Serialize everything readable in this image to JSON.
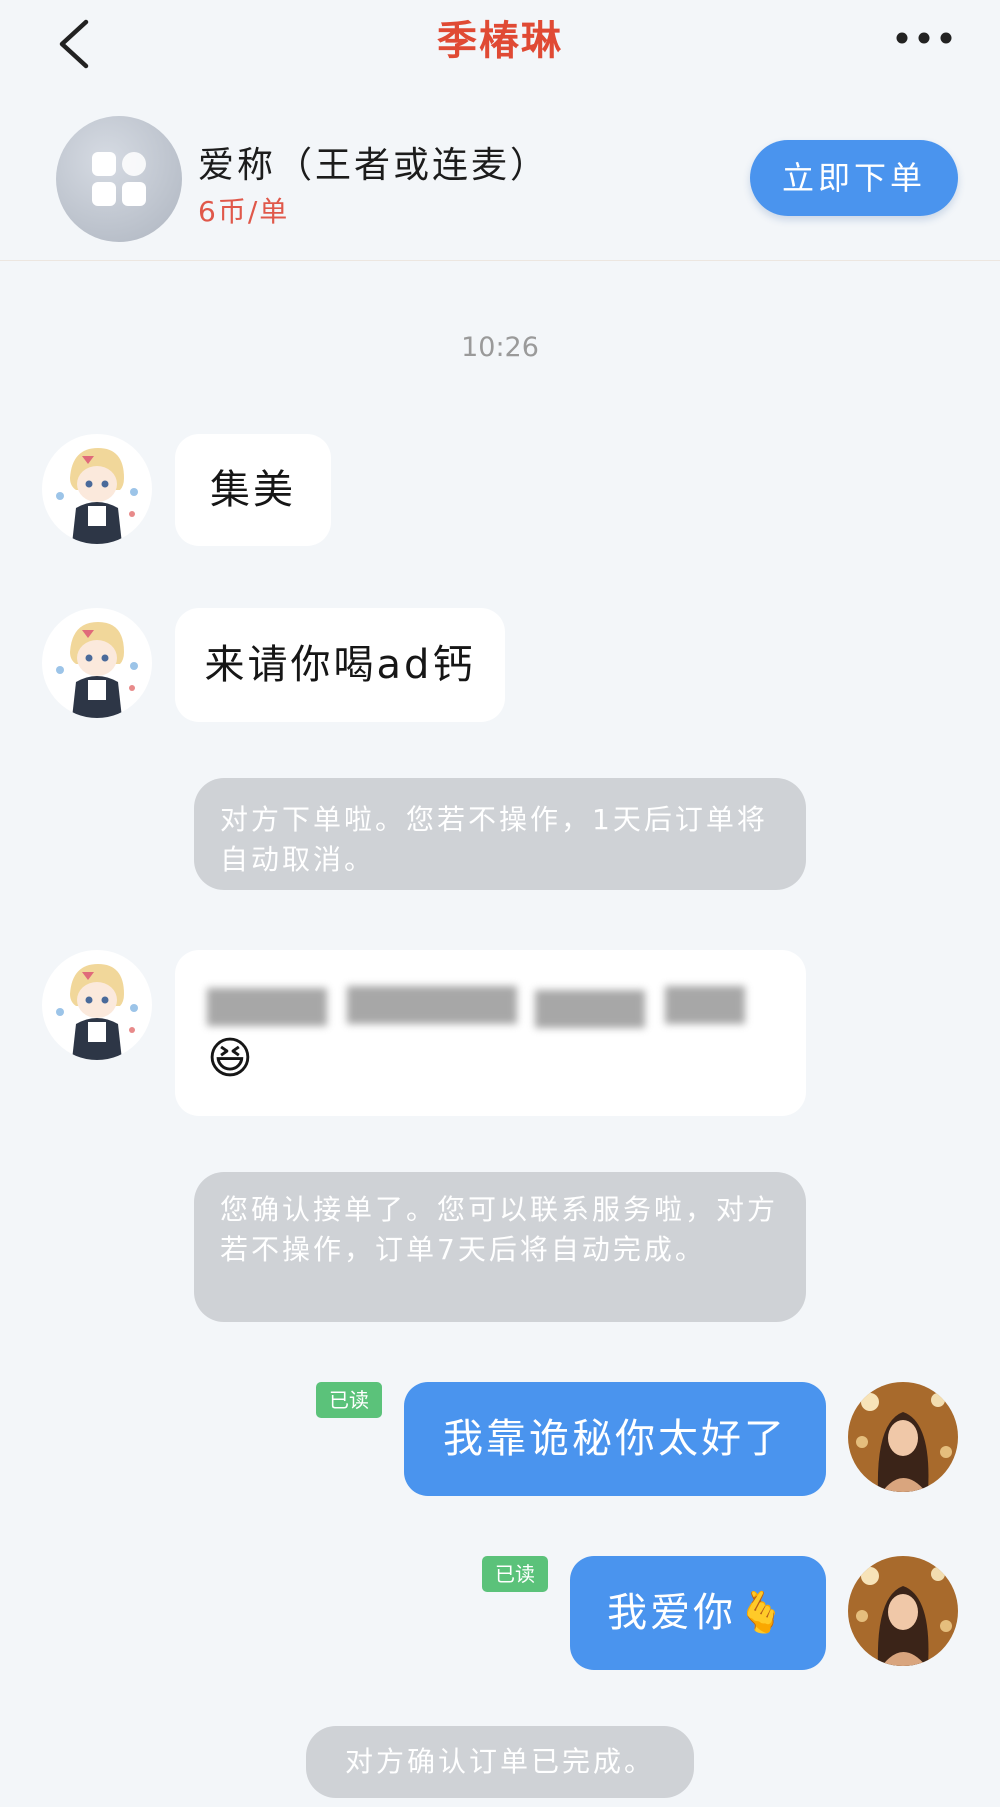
{
  "header": {
    "title": "季椿琳",
    "back_icon": "chevron-left-icon",
    "more_icon": "more-dots-icon"
  },
  "product": {
    "name": "爱称（王者或连麦）",
    "price": "6币/单",
    "order_button": "立即下单",
    "thumb_icon": "app-grid-icon"
  },
  "chat": {
    "timestamp": "10:26",
    "incoming": [
      {
        "text": "集美"
      },
      {
        "text": "来请你喝ad钙"
      },
      {
        "emoji": "😆"
      }
    ],
    "system": [
      "对方下单啦。您若不操作，1天后订单将自动取消。",
      "您确认接单了。您可以联系服务啦，对方若不操作，订单7天后将自动完成。",
      "对方确认订单已完成。"
    ],
    "outgoing": [
      {
        "text": "我靠诡秘你太好了",
        "read": "已读"
      },
      {
        "text": "我爱你🫰",
        "read": "已读"
      }
    ]
  },
  "colors": {
    "title": "#e04a34",
    "accent": "#4a94ee",
    "price": "#e0584a",
    "read_badge": "#5bc27a",
    "system_bubble": "#cfd2d6",
    "background": "#f3f6f9"
  }
}
